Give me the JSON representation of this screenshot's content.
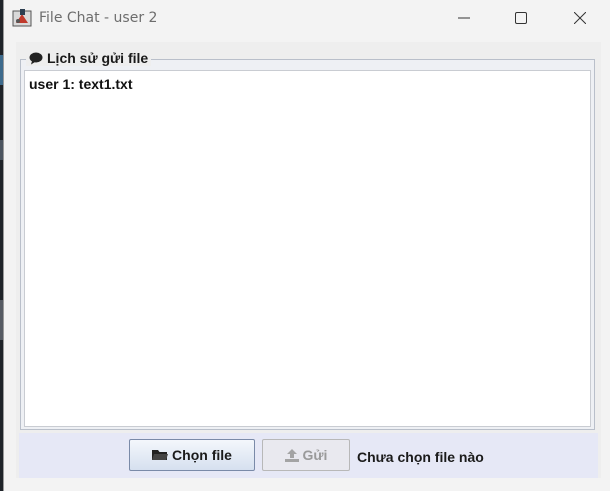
{
  "window": {
    "title": "File Chat - user 2"
  },
  "history": {
    "legend": "Lịch sử gửi file",
    "legend_icon": "speech-bubble-icon",
    "entries": [
      "user 1: text1.txt"
    ]
  },
  "actions": {
    "choose_label": "Chọn file",
    "choose_icon": "folder-icon",
    "send_label": "Gửi",
    "send_icon": "upload-icon",
    "send_enabled": false,
    "status": "Chưa chọn file nào"
  },
  "colors": {
    "panel_bg": "#eeeeee",
    "bottom_bar": "#e6e8f6",
    "button_border": "#7a8aa8",
    "disabled_text": "#9a9a9a"
  }
}
